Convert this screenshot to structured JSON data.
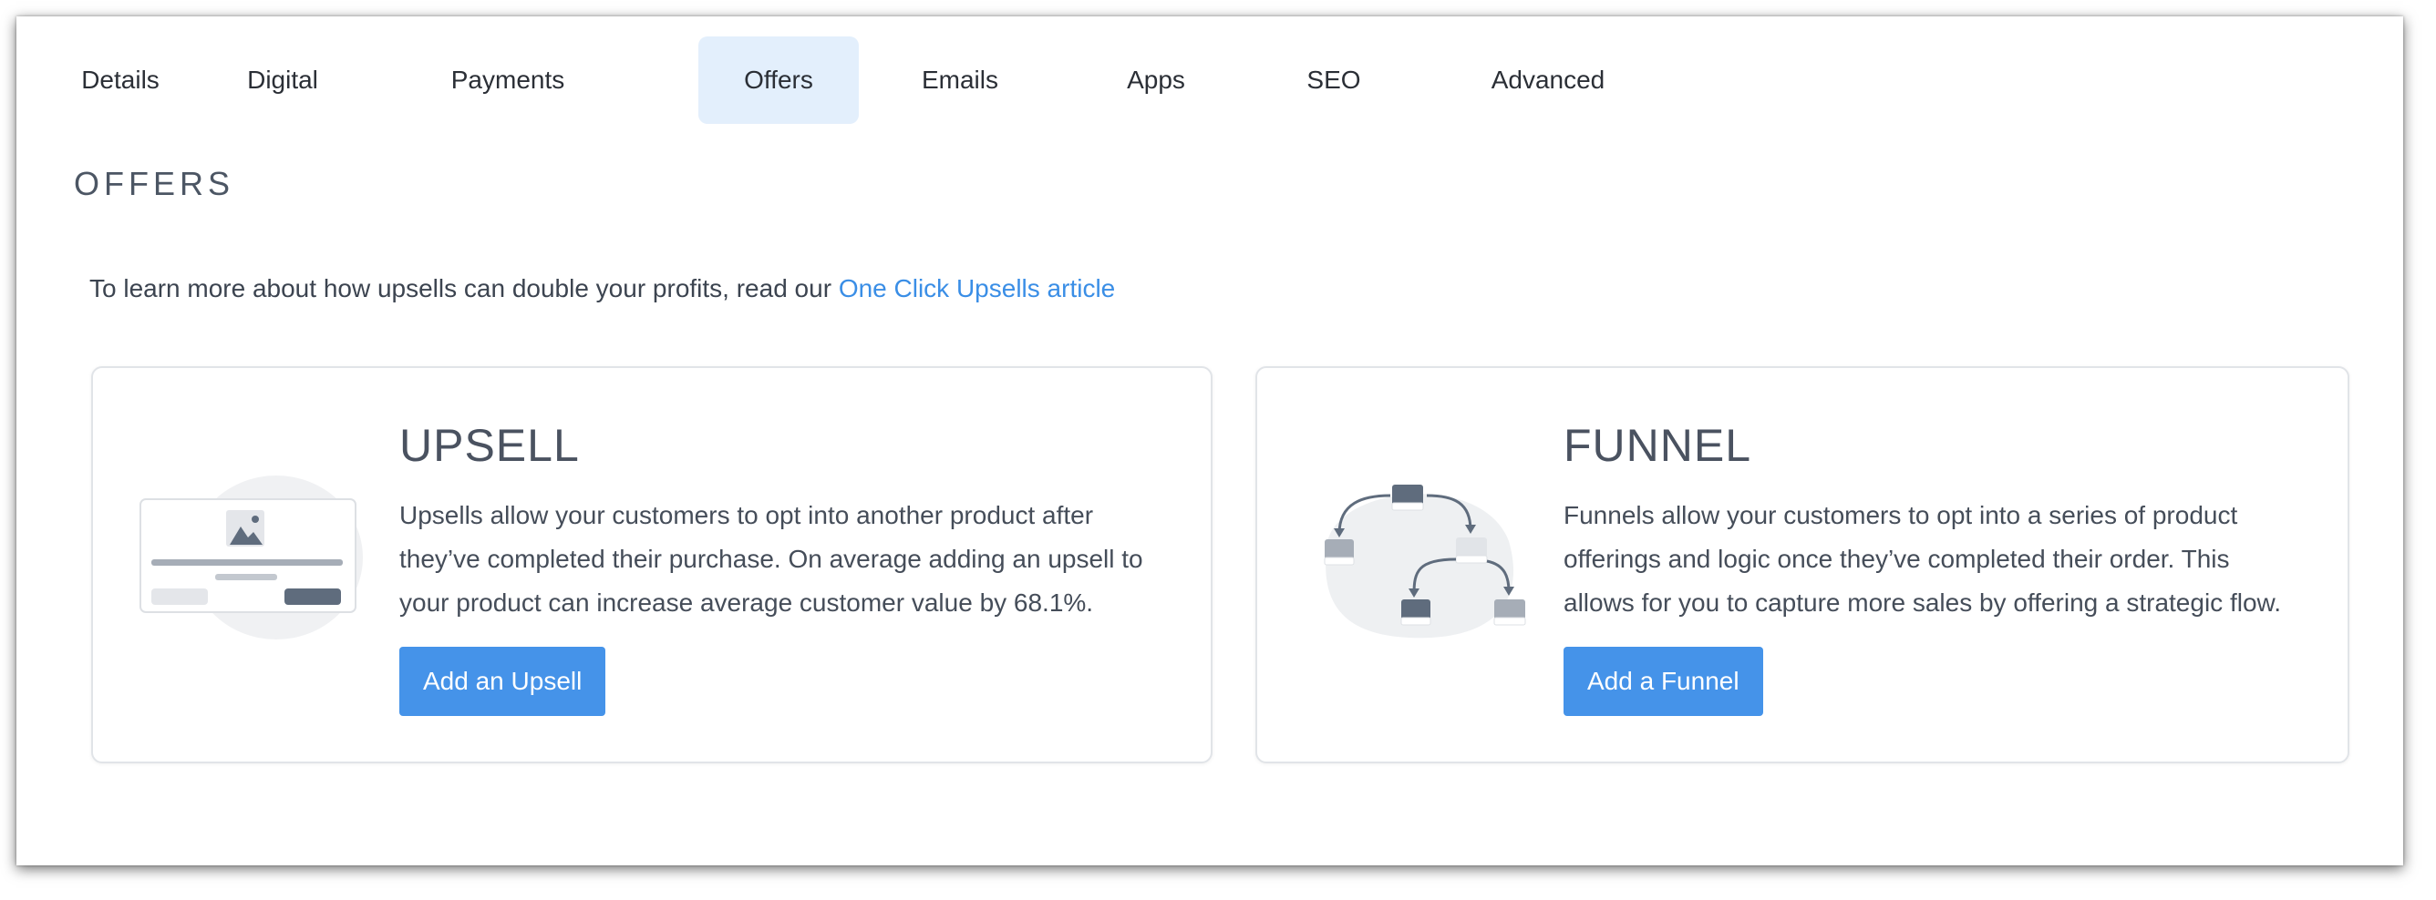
{
  "tabs": [
    {
      "label": "Details"
    },
    {
      "label": "Digital"
    },
    {
      "label": "Payments"
    },
    {
      "label": "Offers",
      "active": true
    },
    {
      "label": "Emails"
    },
    {
      "label": "Apps"
    },
    {
      "label": "SEO"
    },
    {
      "label": "Advanced"
    }
  ],
  "section": {
    "title": "OFFERS",
    "intro_text": "To learn more about how upsells can double your profits, read our ",
    "intro_link": "One Click Upsells article"
  },
  "cards": {
    "upsell": {
      "title": "UPSELL",
      "desc_lines": [
        "Upsells allow your customers to opt into another product after",
        "they’ve completed their purchase. On average adding an upsell to",
        "your product can increase average customer value by 68.1%."
      ],
      "button": "Add an Upsell",
      "icon": "upsell-illustration"
    },
    "funnel": {
      "title": "FUNNEL",
      "desc_lines": [
        "Funnels allow your customers to opt into a series of product",
        "offerings and logic once they’ve completed their order. This",
        "allows for you to capture more sales by offering a strategic flow."
      ],
      "button": "Add a Funnel",
      "icon": "funnel-illustration"
    }
  },
  "colors": {
    "accent": "#4593e9",
    "link": "#3a8ee6",
    "active_tab_bg": "#e3effc",
    "text": "#454d59"
  }
}
